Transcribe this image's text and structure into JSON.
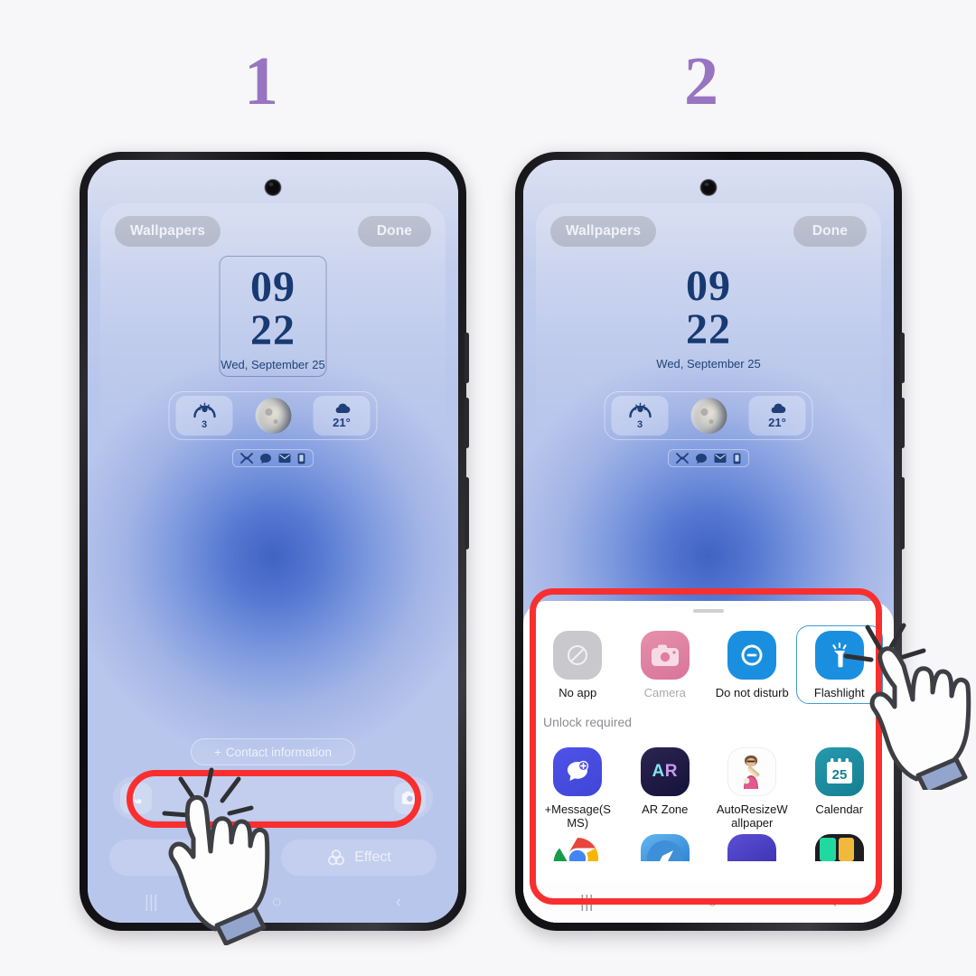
{
  "steps": {
    "one": "1",
    "two": "2"
  },
  "lockscreen": {
    "wallpapers_button": "Wallpapers",
    "done_button": "Done",
    "clock": {
      "hours": "09",
      "minutes": "22",
      "date": "Wed, September 25"
    },
    "widgets": {
      "uv_value": "3",
      "moon_label": "moon-phase",
      "temperature": "21°"
    },
    "contact_information": "Contact information",
    "contact_plus": "+",
    "style_button": "",
    "effect_button": "Effect",
    "shortcuts": {
      "left": "phone-shortcut",
      "right": "camera-shortcut"
    },
    "navbar": {
      "recents": "|||",
      "home": "○",
      "back": "‹"
    }
  },
  "sheet": {
    "section_label": "Unlock required",
    "row1": [
      {
        "label": "No app",
        "icon": "no-app-icon",
        "muted": false,
        "selected": false
      },
      {
        "label": "Camera",
        "icon": "camera-icon",
        "muted": true,
        "selected": false
      },
      {
        "label": "Do not disturb",
        "icon": "do-not-disturb-icon",
        "muted": false,
        "selected": false
      },
      {
        "label": "Flashlight",
        "icon": "flashlight-icon",
        "muted": false,
        "selected": true
      }
    ],
    "row2": [
      {
        "label": "+Message(SMS)",
        "icon": "plus-message-icon"
      },
      {
        "label": "AR Zone",
        "icon": "ar-zone-icon"
      },
      {
        "label": "AutoResizeWallpaper",
        "icon": "autoresize-wallpaper-icon"
      },
      {
        "label": "Calendar",
        "icon": "calendar-icon",
        "day": "25"
      }
    ],
    "row3_partial": [
      {
        "icon": "chrome-icon"
      },
      {
        "icon": "browser-icon"
      },
      {
        "icon": "purple-app-icon"
      },
      {
        "icon": "colorful-app-icon"
      }
    ]
  },
  "colors": {
    "step_number": "#9775c0",
    "highlight": "#f92f2f",
    "accent_blue": "#1a8fe0",
    "selection_border": "#3f9ad8",
    "clock_text": "#173a73",
    "page_background": "#f7f6f8"
  }
}
